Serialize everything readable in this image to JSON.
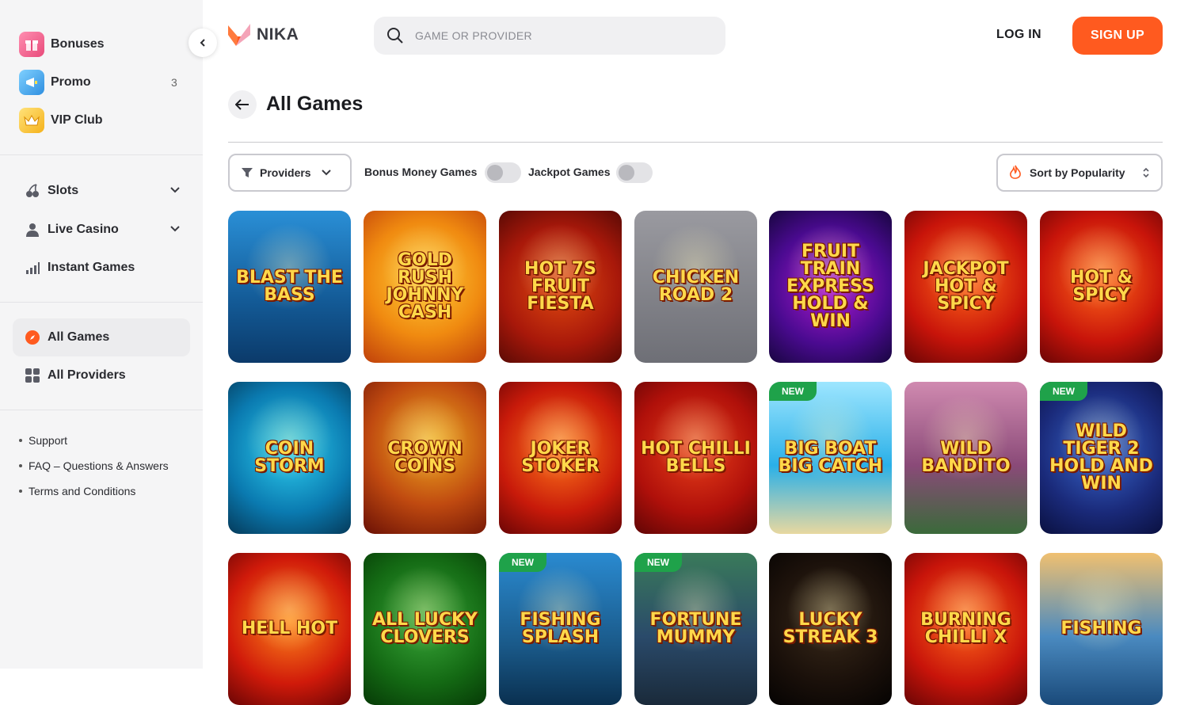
{
  "sidebar": {
    "top_items": [
      {
        "label": "Bonuses",
        "icon": "gift-icon"
      },
      {
        "label": "Promo",
        "icon": "megaphone-icon",
        "count": "3"
      },
      {
        "label": "VIP Club",
        "icon": "crown-icon"
      }
    ],
    "categories": [
      {
        "label": "Slots",
        "icon": "cherry-icon"
      },
      {
        "label": "Live Casino",
        "icon": "dealer-icon"
      },
      {
        "label": "Instant Games",
        "icon": "bar-chart-icon"
      }
    ],
    "browse": [
      {
        "label": "All Games",
        "icon": "compass-icon",
        "active": true
      },
      {
        "label": "All Providers",
        "icon": "grid-icon"
      }
    ],
    "links": [
      "Support",
      "FAQ – Questions & Answers",
      "Terms and Conditions"
    ]
  },
  "header": {
    "logo_text": "NIKA",
    "search_placeholder": "GAME OR PROVIDER",
    "login_label": "LOG IN",
    "signup_label": "SIGN UP"
  },
  "page": {
    "title": "All Games"
  },
  "filters": {
    "providers_label": "Providers",
    "bonus_money_label": "Bonus Money Games",
    "bonus_money_on": false,
    "jackpot_label": "Jackpot Games",
    "jackpot_on": false,
    "sort_label": "Sort by Popularity"
  },
  "colors": {
    "accent": "#ff5a1f",
    "new_badge": "#1fa24a"
  },
  "games": [
    {
      "name": "Blast the Bass",
      "badge": ""
    },
    {
      "name": "Gold Rush Johnny Cash",
      "badge": ""
    },
    {
      "name": "Hot 7s Fruit Fiesta",
      "badge": ""
    },
    {
      "name": "Chicken Road 2",
      "badge": ""
    },
    {
      "name": "Fruit Train Express Hold & Win",
      "badge": ""
    },
    {
      "name": "Jackpot Hot & Spicy",
      "badge": ""
    },
    {
      "name": "Hot & Spicy",
      "badge": ""
    },
    {
      "name": "Coin Storm",
      "badge": ""
    },
    {
      "name": "Crown Coins",
      "badge": ""
    },
    {
      "name": "Joker Stoker",
      "badge": ""
    },
    {
      "name": "Hot Chilli Bells",
      "badge": ""
    },
    {
      "name": "Big Boat Big Catch",
      "badge": "NEW"
    },
    {
      "name": "Wild Bandito",
      "badge": ""
    },
    {
      "name": "Wild Tiger 2 Hold and Win",
      "badge": "NEW"
    },
    {
      "name": "Hell Hot",
      "badge": ""
    },
    {
      "name": "All Lucky Clovers",
      "badge": ""
    },
    {
      "name": "Fishing Splash",
      "badge": "NEW"
    },
    {
      "name": "Fortune Mummy",
      "badge": "NEW"
    },
    {
      "name": "Lucky Streak 3",
      "badge": ""
    },
    {
      "name": "Burning Chilli X",
      "badge": ""
    },
    {
      "name": "Fishing",
      "badge": ""
    }
  ]
}
